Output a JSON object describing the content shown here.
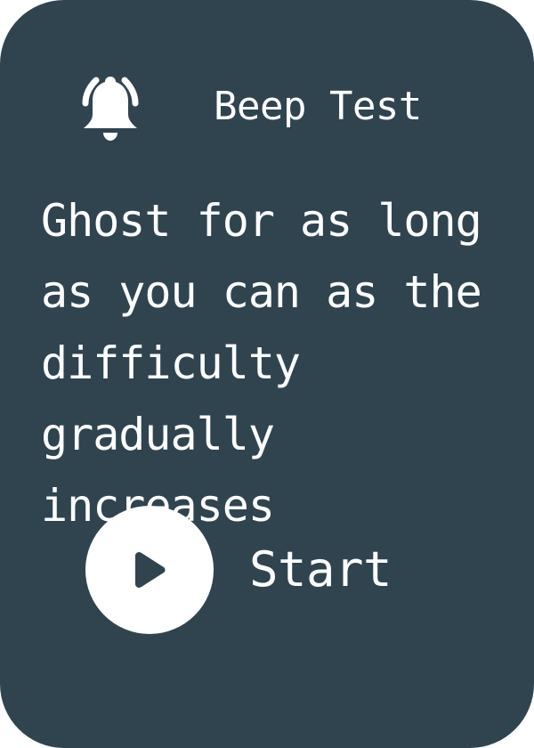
{
  "card": {
    "background": "#30444f",
    "text_color": "#ffffff"
  },
  "header": {
    "icon": "bell-ringing-icon",
    "title": "Beep Test"
  },
  "description": {
    "text": "Ghost for as long as you can as the difficulty gradually increases"
  },
  "start": {
    "icon": "play-icon",
    "label": "Start"
  }
}
